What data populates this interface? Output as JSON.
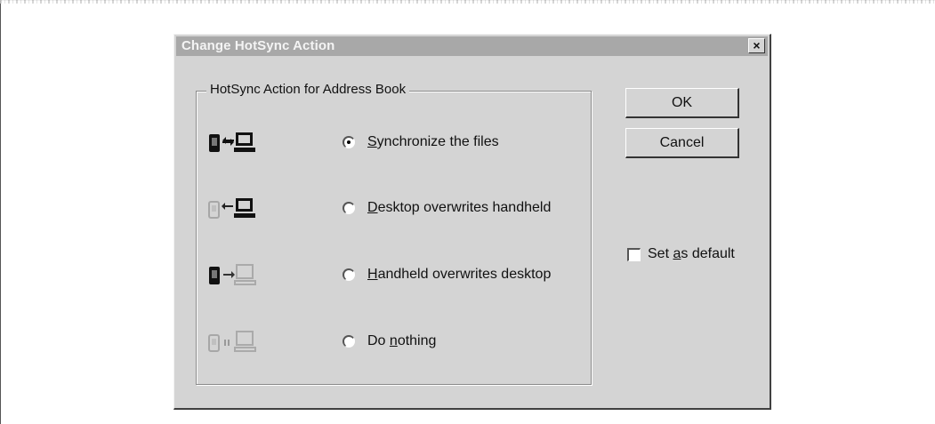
{
  "dialog": {
    "title": "Change HotSync Action",
    "close_label": "×"
  },
  "group": {
    "label": "HotSync Action for Address Book"
  },
  "options": [
    {
      "pre": "",
      "mnemonic": "S",
      "post": "ynchronize the files",
      "checked": true,
      "icon": "sync-both-icon"
    },
    {
      "pre": "",
      "mnemonic": "D",
      "post": "esktop overwrites handheld",
      "checked": false,
      "icon": "desktop-to-handheld-icon"
    },
    {
      "pre": "",
      "mnemonic": "H",
      "post": "andheld overwrites desktop",
      "checked": false,
      "icon": "handheld-to-desktop-icon"
    },
    {
      "pre": "Do ",
      "mnemonic": "n",
      "post": "othing",
      "checked": false,
      "icon": "do-nothing-icon"
    }
  ],
  "buttons": {
    "ok_label": "OK",
    "cancel_label": "Cancel"
  },
  "default_checkbox": {
    "pre": "Set ",
    "mnemonic": "a",
    "post": "s default",
    "checked": false
  }
}
